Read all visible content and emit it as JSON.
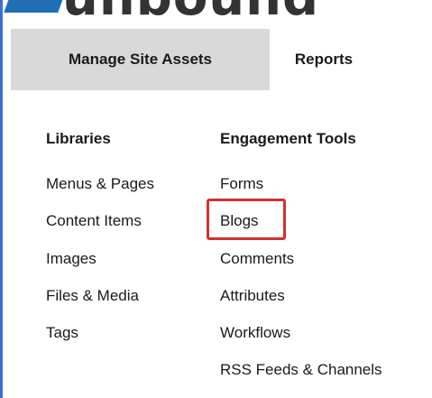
{
  "brand": {
    "logo_text": "unbound",
    "accent_color": "#1f6fb5"
  },
  "tabs": {
    "manage_label": "Manage Site Assets",
    "reports_label": "Reports",
    "active_bg": "#d9d9d9"
  },
  "libraries": {
    "title": "Libraries",
    "items": [
      "Menus & Pages",
      "Content Items",
      "Images",
      "Files & Media",
      "Tags"
    ]
  },
  "engagement": {
    "title": "Engagement Tools",
    "items": [
      "Forms",
      "Blogs",
      "Comments",
      "Attributes",
      "Workflows",
      "RSS Feeds & Channels"
    ]
  },
  "highlight": {
    "target": "Blogs",
    "color": "#d0312d"
  }
}
